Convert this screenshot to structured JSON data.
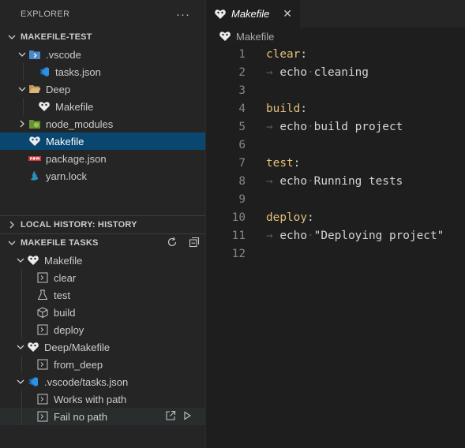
{
  "explorer": {
    "title": "EXPLORER",
    "more": "···",
    "root": "MAKEFILE-TEST",
    "tree": [
      {
        "label": ".vscode",
        "icon": "vscode-folder-icon"
      },
      {
        "label": "tasks.json",
        "icon": "vscode-json-icon"
      },
      {
        "label": "Deep",
        "icon": "folder-open-icon"
      },
      {
        "label": "Makefile",
        "icon": "makefile-icon"
      },
      {
        "label": "node_modules",
        "icon": "node-folder-icon"
      },
      {
        "label": "Makefile",
        "icon": "makefile-icon"
      },
      {
        "label": "package.json",
        "icon": "npm-icon"
      },
      {
        "label": "yarn.lock",
        "icon": "yarn-icon"
      }
    ]
  },
  "local_history": {
    "title": "LOCAL HISTORY: HISTORY"
  },
  "makefile_tasks": {
    "title": "MAKEFILE TASKS",
    "groups": [
      {
        "label": "Makefile",
        "tasks": [
          "clear",
          "test",
          "build",
          "deploy"
        ]
      },
      {
        "label": "Deep/Makefile",
        "tasks": [
          "from_deep"
        ]
      },
      {
        "label": ".vscode/tasks.json",
        "tasks": [
          "Works with path",
          "Fail no path"
        ]
      }
    ]
  },
  "editor": {
    "tab_label": "Makefile",
    "close": "✕",
    "breadcrumb": "Makefile",
    "lines": [
      {
        "n": "1",
        "kw": "clear",
        "rest": ":"
      },
      {
        "n": "2",
        "cmd": "echo",
        "arg": "cleaning"
      },
      {
        "n": "3"
      },
      {
        "n": "4",
        "kw": "build",
        "rest": ":"
      },
      {
        "n": "5",
        "cmd": "echo",
        "arg": "build project"
      },
      {
        "n": "6"
      },
      {
        "n": "7",
        "kw": "test",
        "rest": ":"
      },
      {
        "n": "8",
        "cmd": "echo",
        "arg": "Running tests"
      },
      {
        "n": "9"
      },
      {
        "n": "10",
        "kw": "deploy",
        "rest": ":"
      },
      {
        "n": "11",
        "cmd": "echo",
        "arg": "\"Deploying project\""
      },
      {
        "n": "12"
      }
    ]
  },
  "colors": {
    "selection": "#094771",
    "keyword": "#e5c07b",
    "sidebar": "#252526",
    "editor": "#1e1e1e"
  }
}
